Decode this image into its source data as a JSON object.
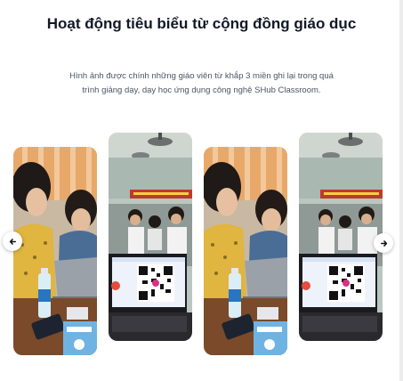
{
  "section": {
    "title": "Hoạt động tiêu biểu từ cộng đồng giáo dục",
    "description": "Hình ảnh được chính những giáo viên từ khắp 3 miền ghi lại trong quá trình giảng dạy, dạy học ứng dụng công nghệ SHub Classroom."
  },
  "carousel": {
    "prev_icon": "chevron-left-icon",
    "next_icon": "chevron-right-icon",
    "slides": [
      {
        "type": "teachers-laptop-photo"
      },
      {
        "type": "classroom-qr-photo"
      },
      {
        "type": "teachers-laptop-photo"
      },
      {
        "type": "classroom-qr-photo"
      }
    ]
  },
  "colors": {
    "heading": "#111827",
    "body_text": "#4b5563",
    "background": "#ffffff"
  }
}
